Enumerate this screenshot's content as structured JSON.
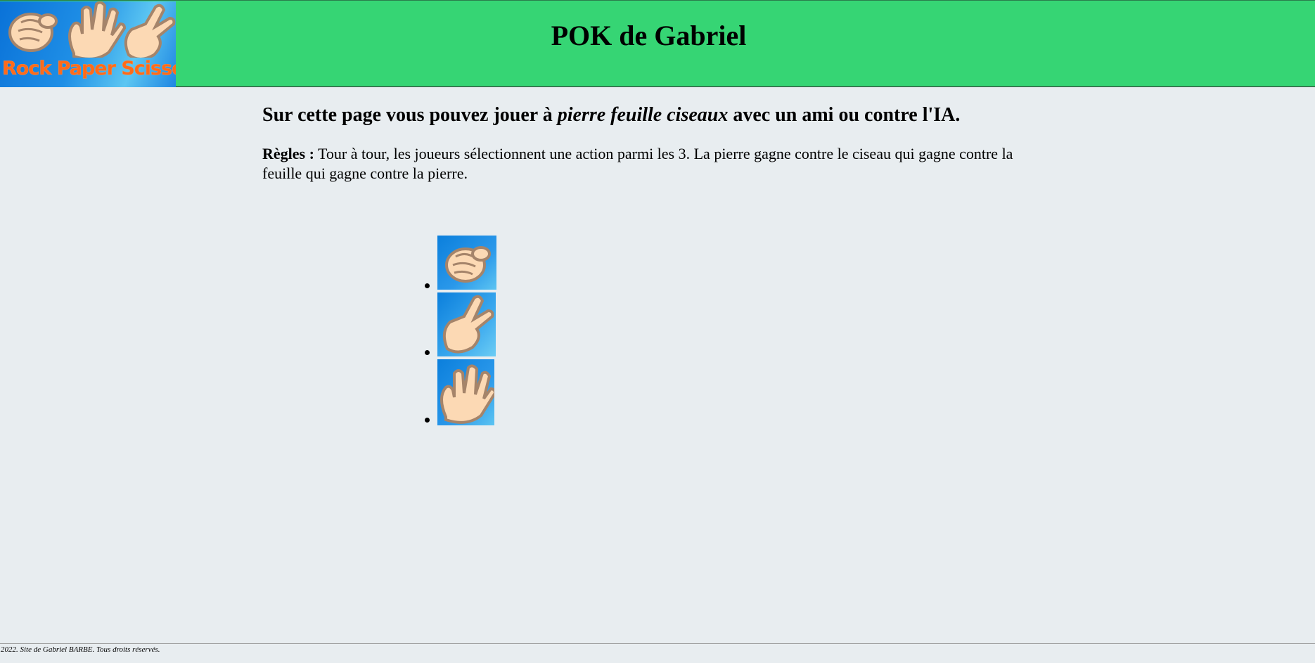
{
  "header": {
    "logo_icons": [
      "rock-hand-icon",
      "paper-hand-icon",
      "scissors-hand-icon"
    ],
    "logo_text": "Rock Paper Scissor",
    "title": "POK de Gabriel",
    "background_color": "#36d574"
  },
  "main": {
    "intro_prefix": "Sur cette page vous pouvez jouer à ",
    "intro_game": "pierre feuille ciseaux",
    "intro_suffix": " avec un ami ou contre l'IA.",
    "rules_label": "Règles :",
    "rules_text": " Tour à tour, les joueurs sélectionnent une action parmi les 3. La pierre gagne contre le ciseau qui gagne contre la feuille qui gagne contre la pierre."
  },
  "choices": [
    {
      "icon": "rock-hand-icon"
    },
    {
      "icon": "scissors-hand-icon"
    },
    {
      "icon": "paper-hand-icon"
    }
  ],
  "footer": {
    "text": "2022. Site de Gabriel BARBE. Tous droits réservés."
  }
}
